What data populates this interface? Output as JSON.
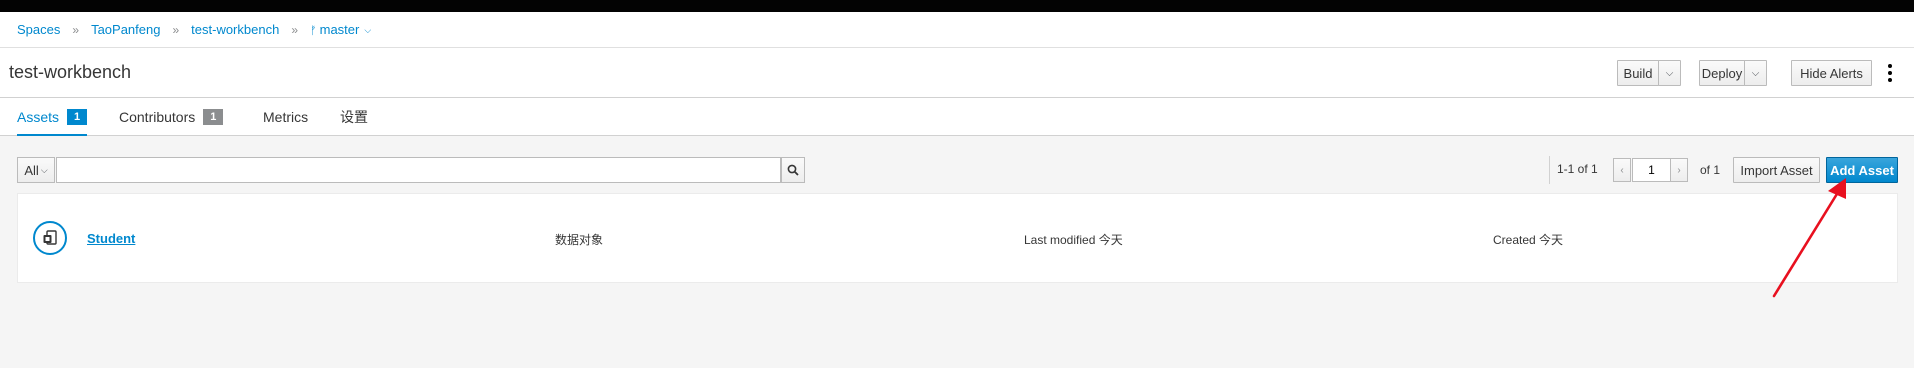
{
  "breadcrumb": {
    "items": [
      "Spaces",
      "TaoPanfeng",
      "test-workbench"
    ],
    "branch": "master",
    "separator": "»"
  },
  "header": {
    "title": "test-workbench",
    "buttons": {
      "build": "Build",
      "deploy": "Deploy",
      "hide_alerts": "Hide Alerts"
    }
  },
  "tabs": [
    {
      "label": "Assets",
      "badge": "1"
    },
    {
      "label": "Contributors",
      "badge": "1"
    },
    {
      "label": "Metrics"
    },
    {
      "label": "设置"
    }
  ],
  "toolbar": {
    "filter_value": "All",
    "search_value": "",
    "page_range": "1-1 of 1",
    "page_number": "1",
    "of_pages": "of 1",
    "import_label": "Import Asset",
    "add_label": "Add Asset"
  },
  "assets": [
    {
      "name": "Student",
      "type": "数据对象",
      "modified": "Last modified 今天",
      "created": "Created 今天"
    }
  ],
  "colors": {
    "accent": "#0088ce",
    "annotation_arrow": "#e8101f"
  }
}
